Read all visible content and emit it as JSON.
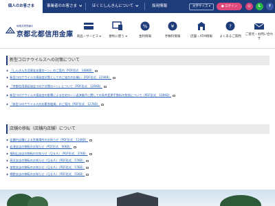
{
  "colors": {
    "navy": "#1e3b7a",
    "pink": "#e0477a",
    "link": "#1e5bb0",
    "gray_band": "#eaeaea"
  },
  "topnav": {
    "tabs": [
      {
        "label": "個人のお客さま",
        "active": true
      },
      {
        "label": "事業者のお客さま",
        "active": false
      },
      {
        "label": "ほくとしんきんについて",
        "active": false
      },
      {
        "label": "採用情報",
        "active": false
      }
    ],
    "font_size_label": "文字サイズ",
    "login_label": "ログイン",
    "social": [
      {
        "icon": "instagram-icon",
        "glyph": "◎",
        "color": "#d6417a"
      },
      {
        "icon": "line-icon",
        "glyph": "L",
        "color": "#28b446"
      },
      {
        "icon": "facebook-icon",
        "glyph": "f",
        "color": "#3b5ba7"
      }
    ]
  },
  "logo": {
    "sub": "地域共栄貢献の",
    "name": "京都北都信用金庫"
  },
  "menu": [
    {
      "label": "商品・サービス",
      "icon": "card-icon"
    },
    {
      "label": "便利に使う",
      "icon": "monitor-icon"
    },
    {
      "label": "金利情報",
      "icon": "percent-icon"
    },
    {
      "label": "手数料情報",
      "icon": "yen-icon"
    },
    {
      "label": "店舗・ATM情報",
      "icon": "shop-icon"
    },
    {
      "label": "よくあるご質問",
      "icon": "question-icon"
    },
    {
      "label": "ご意見・お問い合わせ",
      "icon": "mail-icon"
    }
  ],
  "corona": {
    "title": "新型コロナウイルスへの対策について",
    "links": [
      "「しんきん生活資金支援ローン」のご案内（PDF形式　168KB）",
      "新型コロナウイルス感染症対策としてのご協力のお願い（PDF形式　219KB）",
      "「京都信用保証協会コロナ対策ローン」について（PDF形式　126KB）",
      "新型コロナウイルス感染症の影響による住宅ローン返済猶予に関しての条件変更手数料の免除について（PDF形式　109KB）",
      "「新型コロナウイルス対応緊急融資」のご案内（PDF形式　127KB）"
    ]
  },
  "branch": {
    "title": "店舗の移転（店舗内店舗）について",
    "links": [
      "店舗内店舗による営業場所のお知らせ（PDF形式　124KB）",
      "岩滝支店の移転のお知らせ（PDF形式　90KB）",
      "福知山支店の移転のお知らせ（Ｑ＆Ａ）（PDF形式　37KB）",
      "高浜支店の移転のお知らせ（Ｑ＆Ａ）（PDF形式　57KB）",
      "加悦支店の移転のお知らせ（Ｑ＆Ａ）（PDF形式　57KB）",
      "網野支店の移転のお知らせ（Ｑ＆Ａ）（PDF形式　55KB）"
    ]
  }
}
